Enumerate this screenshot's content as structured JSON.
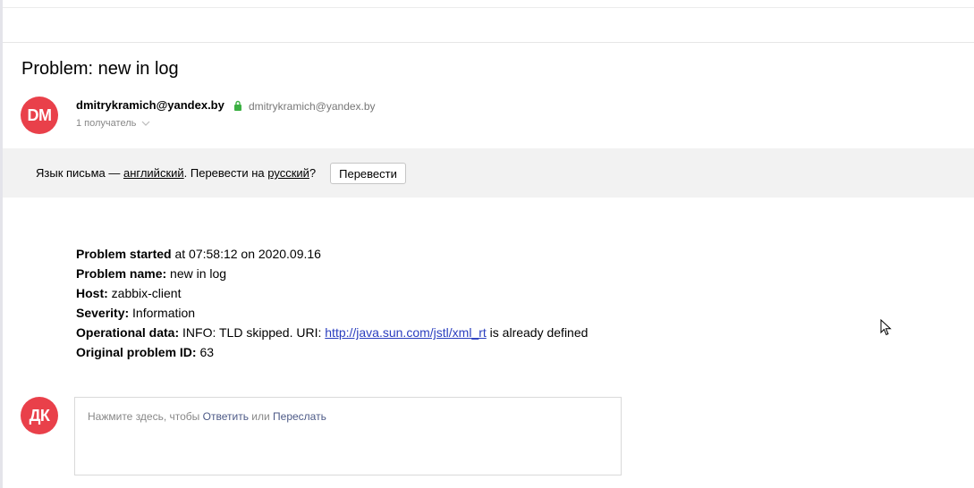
{
  "subject": "Problem: new in log",
  "sender": {
    "initials": "DM",
    "name": "dmitrykramich@yandex.by",
    "email": "dmitrykramich@yandex.by",
    "recipients": "1 получатель"
  },
  "translate": {
    "prefix": "Язык письма — ",
    "language": "английский",
    "middle": ". Перевести на ",
    "target": "русский",
    "suffix": "?",
    "button": "Перевести"
  },
  "body": {
    "line1_label": "Problem started",
    "line1_value": " at 07:58:12 on 2020.09.16",
    "line2_label": "Problem name:",
    "line2_value": " new in log",
    "line3_label": "Host:",
    "line3_value": " zabbix-client",
    "line4_label": "Severity:",
    "line4_value": " Information",
    "line5_label": "Operational data:",
    "line5_prefix": " INFO: TLD skipped. URI: ",
    "line5_link": "http://java.sun.com/jstl/xml_rt",
    "line5_suffix": " is already defined",
    "line6_label": "Original problem ID:",
    "line6_value": " 63"
  },
  "reply": {
    "initials": "ДК",
    "prefix": "Нажмите здесь, чтобы ",
    "reply_link": "Ответить",
    "middle": " или ",
    "forward_link": "Переслать"
  },
  "colors": {
    "avatar": "#e9404a",
    "link": "#2a3ebf",
    "lock": "#3cb043"
  }
}
